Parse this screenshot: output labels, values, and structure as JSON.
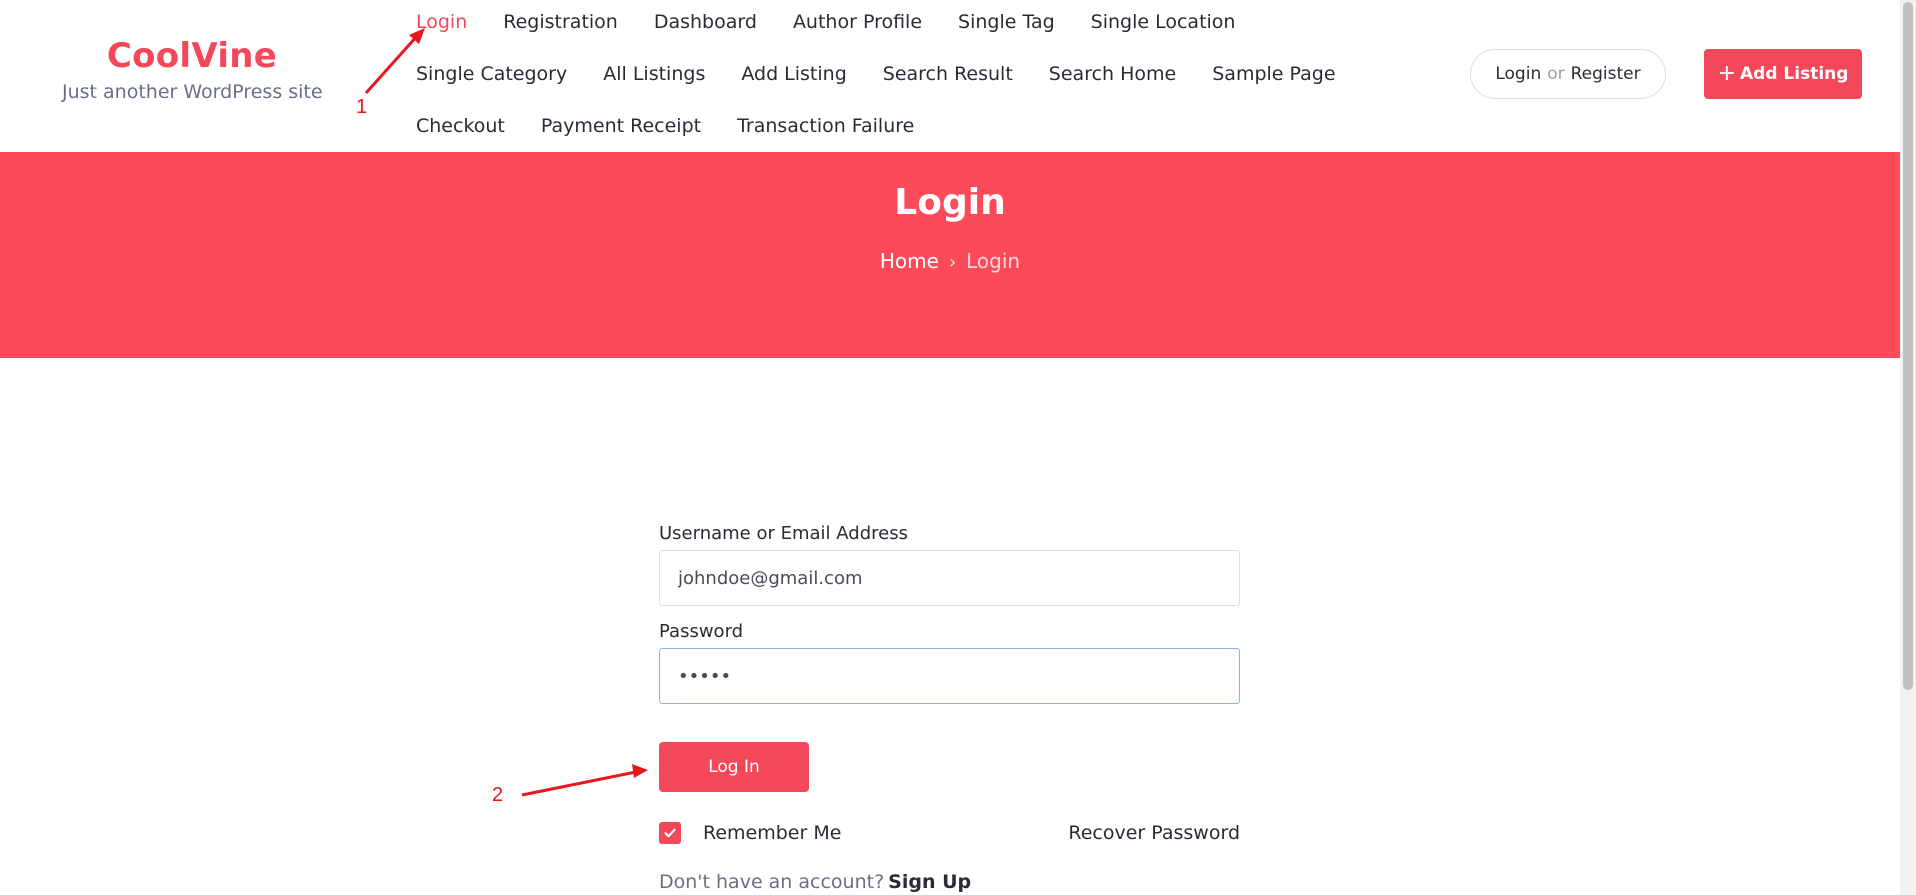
{
  "brand": {
    "title": "CoolVine",
    "tagline": "Just another WordPress site"
  },
  "nav": {
    "row1": [
      "Login",
      "Registration",
      "Dashboard",
      "Author Profile",
      "Single Tag",
      "Single Location"
    ],
    "row2": [
      "Single Category",
      "All Listings",
      "Add Listing",
      "Search Result",
      "Search Home",
      "Sample Page"
    ],
    "row3": [
      "Checkout",
      "Payment Receipt",
      "Transaction Failure"
    ],
    "active": "Login"
  },
  "header_actions": {
    "login": "Login",
    "or": "or",
    "register": "Register",
    "add_listing": "Add Listing",
    "add_icon": "plus-icon"
  },
  "banner": {
    "title": "Login",
    "crumb_home": "Home",
    "crumb_current": "Login",
    "separator_icon": "chevron-right-icon"
  },
  "form": {
    "username_label": "Username or Email Address",
    "username_value": "johndoe@gmail.com",
    "password_label": "Password",
    "password_value": "•••••",
    "submit_label": "Log In",
    "remember_label": "Remember Me",
    "remember_checked": true,
    "recover_label": "Recover Password",
    "signup_prompt": "Don't have an account?",
    "signup_link": "Sign Up"
  },
  "annotations": {
    "step1": "1",
    "step2": "2"
  },
  "colors": {
    "accent": "#f2485a",
    "banner": "#fb4a58",
    "annotation": "#e8161e"
  }
}
